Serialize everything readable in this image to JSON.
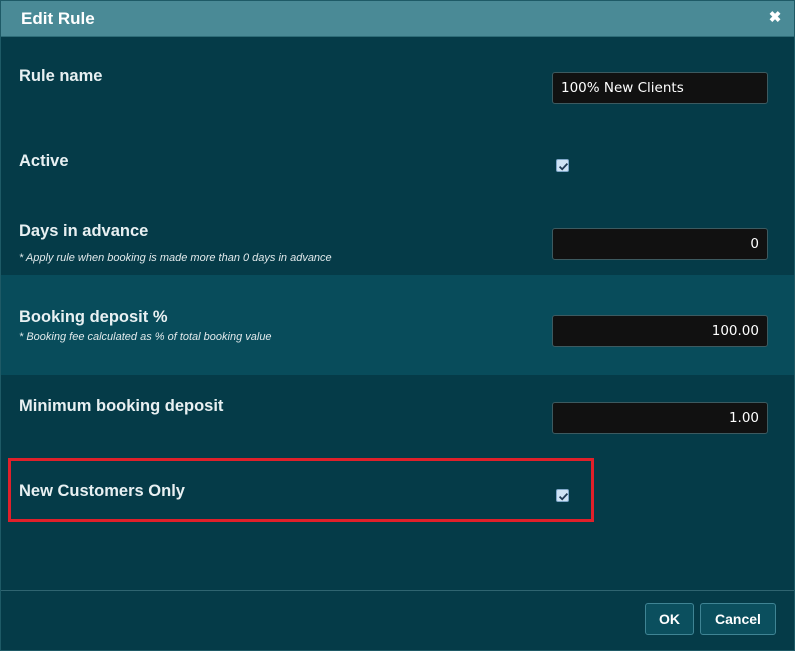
{
  "dialog": {
    "title": "Edit Rule",
    "close_glyph": "✖"
  },
  "fields": {
    "rule_name": {
      "label": "Rule name",
      "value": "100% New Clients"
    },
    "active": {
      "label": "Active",
      "checked": true
    },
    "days_in_advance": {
      "label": "Days in advance",
      "hint": "* Apply rule when booking is made more than 0 days in advance",
      "value": "0"
    },
    "booking_deposit": {
      "label": "Booking deposit %",
      "hint": "* Booking fee calculated as % of total booking value",
      "value": "100.00"
    },
    "minimum_deposit": {
      "label": "Minimum booking deposit",
      "value": "1.00"
    },
    "new_customers_only": {
      "label": "New Customers Only",
      "checked": true
    }
  },
  "buttons": {
    "ok": "OK",
    "cancel": "Cancel"
  },
  "colors": {
    "background": "#053b48",
    "titlebar": "#4a8a96",
    "highlighted_row": "#084c5b",
    "highlight_border": "#e0202a"
  }
}
